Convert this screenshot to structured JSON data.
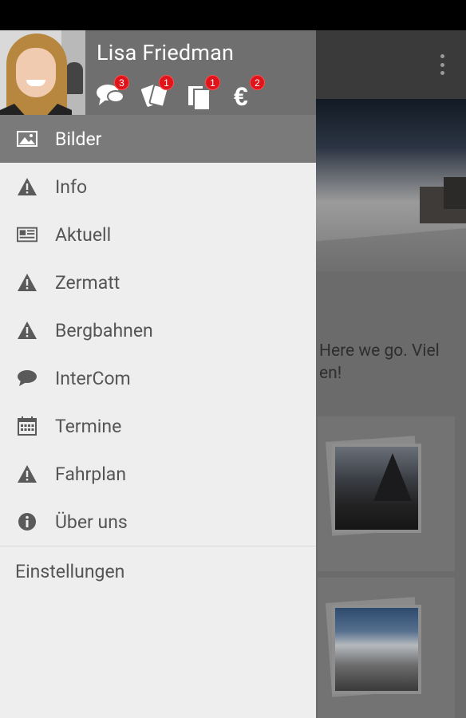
{
  "user": {
    "name": "Lisa Friedman"
  },
  "badges": [
    {
      "icon": "chat-bubbles-icon",
      "count": "3"
    },
    {
      "icon": "tickets-icon",
      "count": "1"
    },
    {
      "icon": "documents-icon",
      "count": "1"
    },
    {
      "icon": "euro-icon",
      "count": "2"
    }
  ],
  "menu": [
    {
      "label": "Bilder",
      "icon": "image-icon",
      "active": true
    },
    {
      "label": "Info",
      "icon": "warning-icon"
    },
    {
      "label": "Aktuell",
      "icon": "newspaper-icon"
    },
    {
      "label": "Zermatt",
      "icon": "warning-icon"
    },
    {
      "label": "Bergbahnen",
      "icon": "warning-icon"
    },
    {
      "label": "InterCom",
      "icon": "chat-bubble-icon"
    },
    {
      "label": "Termine",
      "icon": "calendar-icon"
    },
    {
      "label": "Fahrplan",
      "icon": "warning-icon"
    },
    {
      "label": "Über uns",
      "icon": "info-icon"
    }
  ],
  "settings": {
    "label": "Einstellungen"
  },
  "background": {
    "text_line1": "Here we go. Viel",
    "text_line2": "en!"
  },
  "colors": {
    "drawer_bg": "#eeeeee",
    "profile_bg": "#6f6f6f",
    "active_item_bg": "#7a7a7a",
    "badge_red": "#e0141b"
  }
}
